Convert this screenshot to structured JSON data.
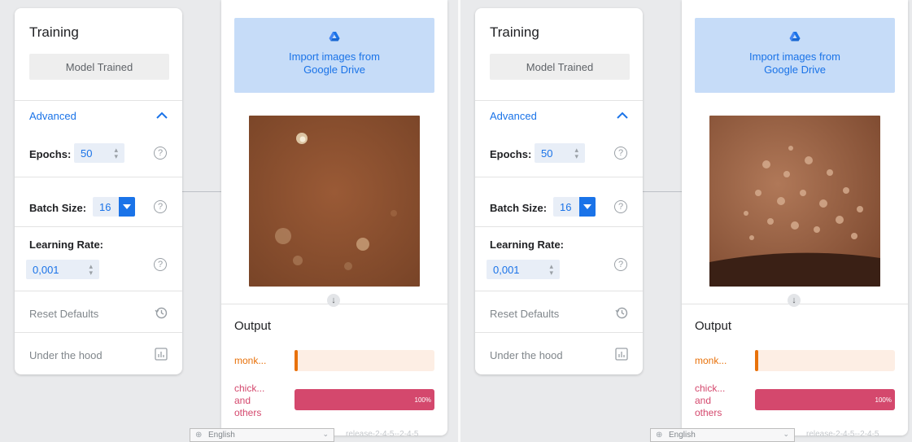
{
  "panels": [
    {
      "training": {
        "title": "Training",
        "trained_button": "Model Trained",
        "advanced_label": "Advanced",
        "epochs_label": "Epochs:",
        "epochs_value": "50",
        "batch_size_label": "Batch Size:",
        "batch_size_value": "16",
        "learning_rate_label": "Learning Rate:",
        "learning_rate_value": "0,001",
        "reset_defaults": "Reset Defaults",
        "under_the_hood": "Under the hood"
      },
      "preview": {
        "import_button": "Import images from\nGoogle Drive",
        "output_title": "Output",
        "classes": [
          {
            "label": "monk...",
            "percent": 0,
            "percent_text": "",
            "color": "#e8710a",
            "track_color": "#fdeee4"
          },
          {
            "label": "chick...\nand\nothers",
            "percent": 100,
            "percent_text": "100%",
            "color": "#d4486d",
            "track_color": "#f9dbe3"
          }
        ]
      },
      "footer": {
        "language": "English",
        "version": "release-2-4-5--2-4-5"
      }
    },
    {
      "training": {
        "title": "Training",
        "trained_button": "Model Trained",
        "advanced_label": "Advanced",
        "epochs_label": "Epochs:",
        "epochs_value": "50",
        "batch_size_label": "Batch Size:",
        "batch_size_value": "16",
        "learning_rate_label": "Learning Rate:",
        "learning_rate_value": "0,001",
        "reset_defaults": "Reset Defaults",
        "under_the_hood": "Under the hood"
      },
      "preview": {
        "import_button": "Import images from\nGoogle Drive",
        "output_title": "Output",
        "classes": [
          {
            "label": "monk...",
            "percent": 0,
            "percent_text": "",
            "color": "#e8710a",
            "track_color": "#fdeee4"
          },
          {
            "label": "chick...\nand\nothers",
            "percent": 100,
            "percent_text": "100%",
            "color": "#d4486d",
            "track_color": "#f9dbe3"
          }
        ]
      },
      "footer": {
        "language": "English",
        "version": "release-2-4-5--2-4-5"
      }
    }
  ]
}
